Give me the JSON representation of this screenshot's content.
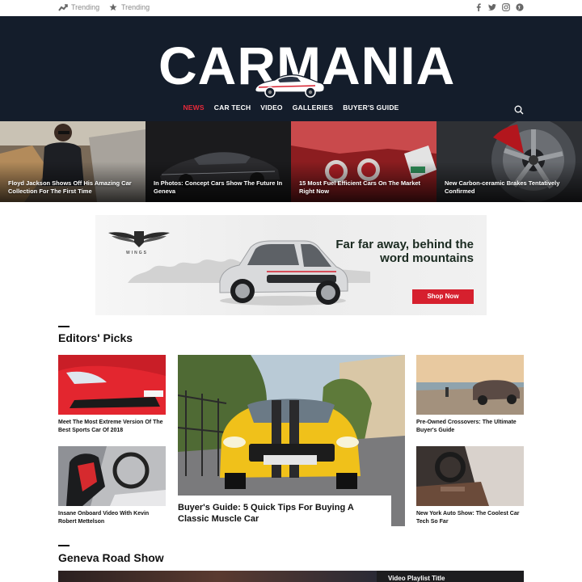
{
  "topbar": {
    "links": [
      {
        "label": "Trending",
        "icon": "trending-icon"
      },
      {
        "label": "Trending",
        "icon": "star-icon"
      }
    ],
    "socials": [
      "facebook-icon",
      "twitter-icon",
      "instagram-icon",
      "pinterest-icon"
    ]
  },
  "header": {
    "logo": "CARMANIA",
    "nav": [
      "NEWS",
      "CAR TECH",
      "VIDEO",
      "GALLERIES",
      "BUYER'S GUIDE"
    ],
    "active_nav": "NEWS",
    "accent": "#e8293a",
    "background": "#141d2b"
  },
  "featured": [
    {
      "title": "Floyd Jackson Shows Off His Amazing Car Collection For The First Time"
    },
    {
      "title": "In Photos: Concept Cars Show The Future In Geneva"
    },
    {
      "title": "15 Most Fuel Efficient Cars On The Market Right Now"
    },
    {
      "title": "New Carbon-ceramic Brakes Tentatively Confirmed"
    }
  ],
  "ad": {
    "brand": "WINGS",
    "headline": "Far far away, behind the word mountains",
    "cta": "Shop Now"
  },
  "editors_picks": {
    "title": "Editors' Picks",
    "left": [
      {
        "title": "Meet The Most Extreme Version Of The Best Sports Car Of 2018"
      },
      {
        "title": "Insane Onboard Video With Kevin Robert Mettelson"
      }
    ],
    "main": {
      "title": "Buyer's Guide: 5 Quick Tips For Buying A Classic Muscle Car"
    },
    "right": [
      {
        "title": "Pre-Owned Crossovers: The Ultimate Buyer's Guide"
      },
      {
        "title": "New York Auto Show: The Coolest Car Tech So Far"
      }
    ]
  },
  "geneva": {
    "title": "Geneva Road Show",
    "playlist_title": "Video Playlist Title"
  }
}
